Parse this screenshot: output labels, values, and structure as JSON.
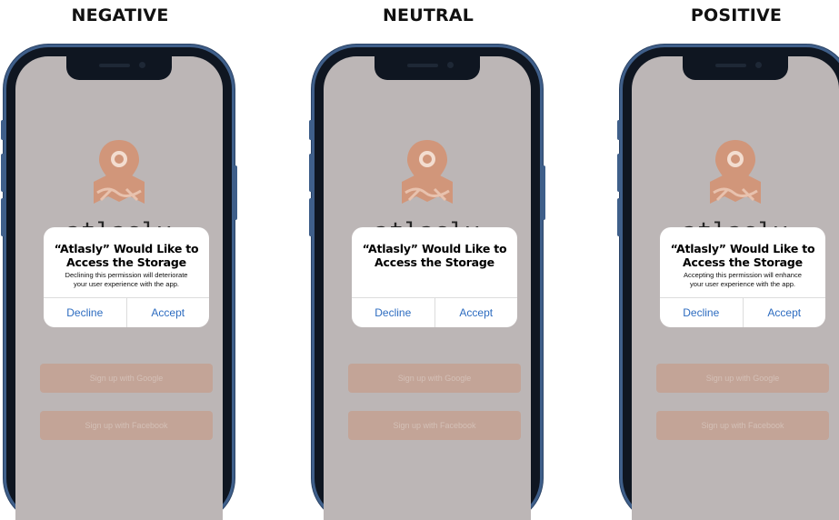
{
  "brand": {
    "name": "atlasly",
    "logo_icon": "map-pin-icon",
    "logo_color": "#d1967a"
  },
  "signup": {
    "google_label": "Sign up with Google",
    "facebook_label": "Sign up with Facebook"
  },
  "variants": [
    {
      "heading": "NEGATIVE",
      "dialog": {
        "title_line1": "“Atlasly” Would Like to",
        "title_line2": "Access the Storage",
        "message_line1": "Declining this permission will deteriorate",
        "message_line2": "your user experience with the app.",
        "decline_label": "Decline",
        "accept_label": "Accept"
      }
    },
    {
      "heading": "NEUTRAL",
      "dialog": {
        "title_line1": "“Atlasly” Would Like to",
        "title_line2": "Access the Storage",
        "message_line1": "",
        "message_line2": "",
        "decline_label": "Decline",
        "accept_label": "Accept"
      }
    },
    {
      "heading": "POSITIVE",
      "dialog": {
        "title_line1": "“Atlasly” Would Like to",
        "title_line2": "Access the Storage",
        "message_line1": "Accepting this permission will enhance",
        "message_line2": "your user experience with the app.",
        "decline_label": "Decline",
        "accept_label": "Accept"
      }
    }
  ],
  "colors": {
    "phone_frame": "#3f5f8a",
    "screen_overlay": "#bcb6b6",
    "button_fill": "#c3a497",
    "dialog_action": "#2d6cc0"
  }
}
